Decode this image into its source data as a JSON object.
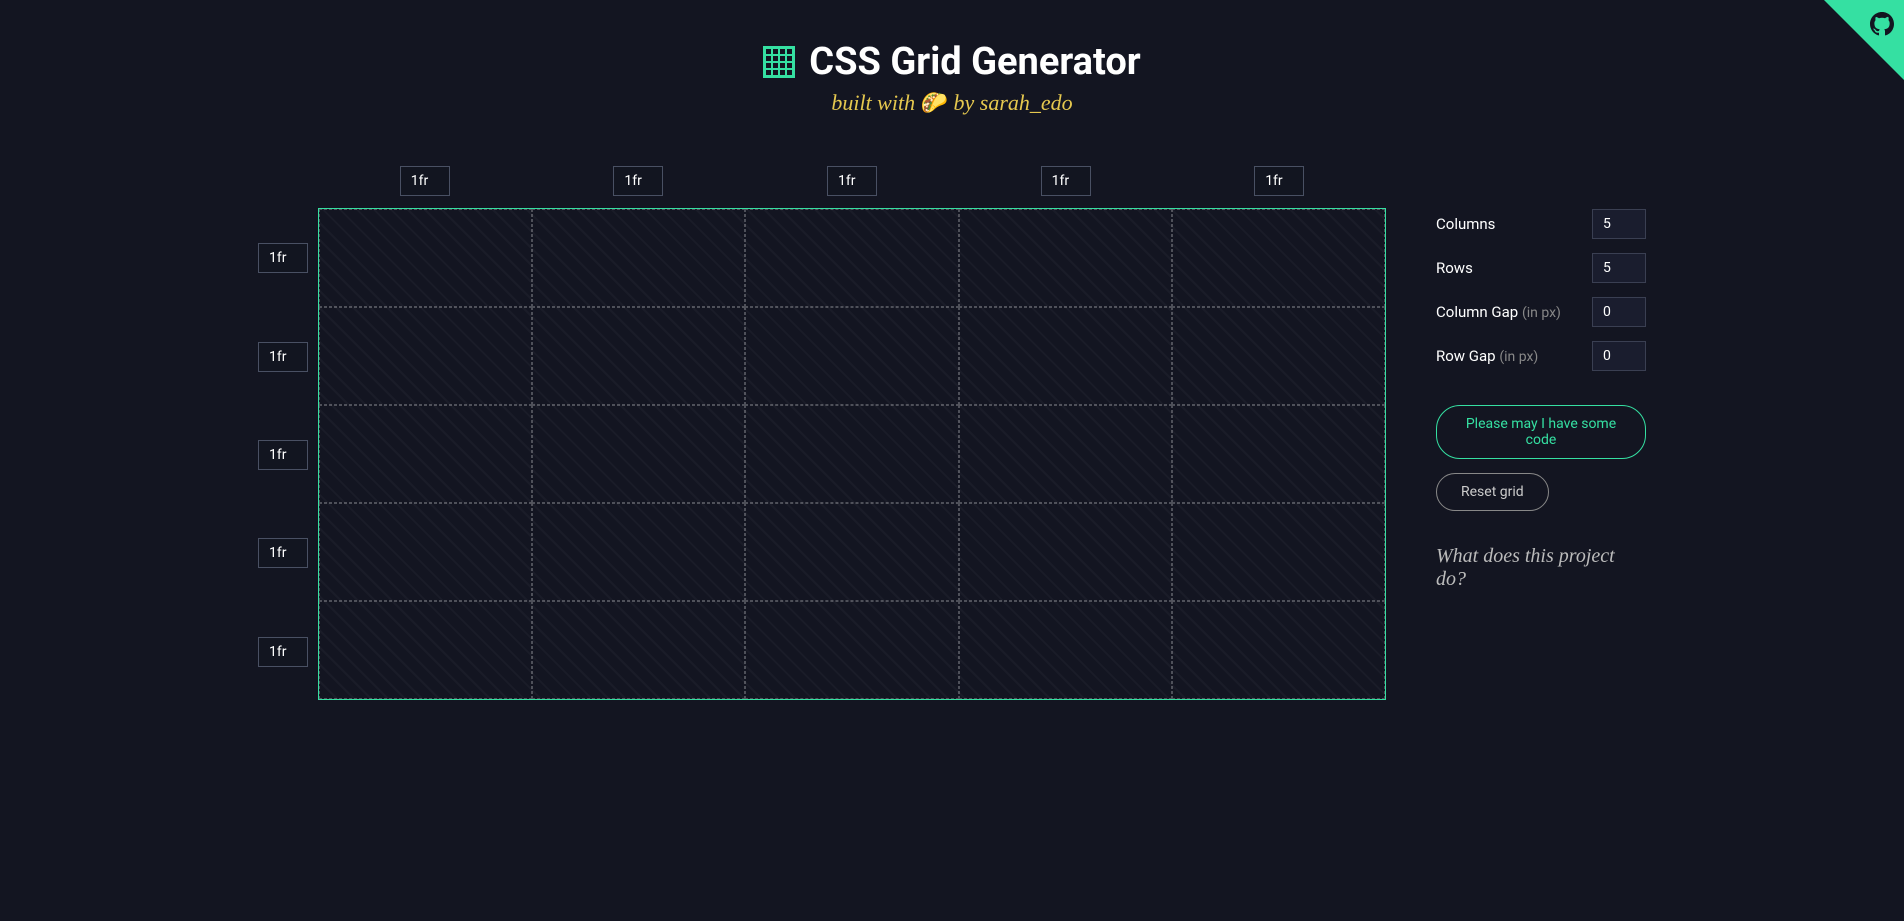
{
  "header": {
    "title": "CSS Grid Generator",
    "subtitle_prefix": "built with",
    "subtitle_emoji": "🌮",
    "subtitle_by": "by",
    "subtitle_author": "sarah_edo"
  },
  "grid": {
    "columns": 5,
    "rows": 5,
    "column_units": [
      "1fr",
      "1fr",
      "1fr",
      "1fr",
      "1fr"
    ],
    "row_units": [
      "1fr",
      "1fr",
      "1fr",
      "1fr",
      "1fr"
    ]
  },
  "controls": {
    "columns_label": "Columns",
    "columns_value": "5",
    "rows_label": "Rows",
    "rows_value": "5",
    "column_gap_label": "Column Gap",
    "column_gap_unit": "(in px)",
    "column_gap_value": "0",
    "row_gap_label": "Row Gap",
    "row_gap_unit": "(in px)",
    "row_gap_value": "0",
    "generate_button": "Please may I have some code",
    "reset_button": "Reset grid",
    "info_link": "What does this project do?"
  },
  "colors": {
    "background": "#131521",
    "accent": "#35e0a2",
    "subtitle": "#e5c84f"
  }
}
